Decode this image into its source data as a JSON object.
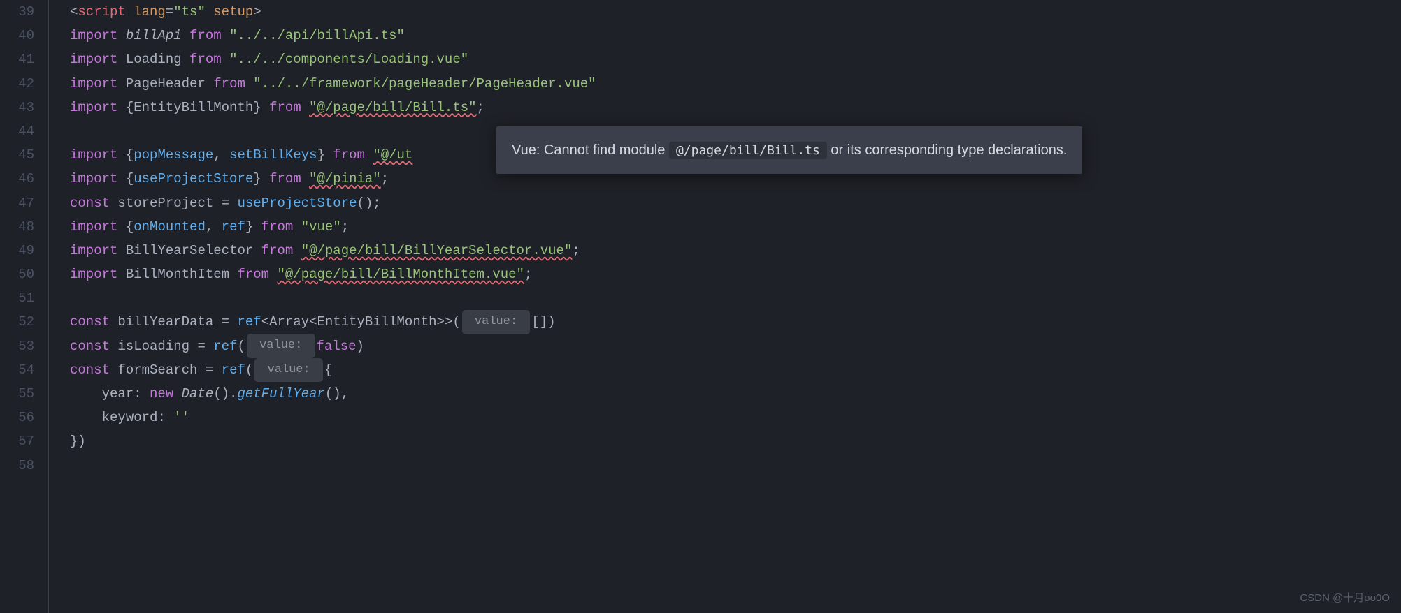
{
  "gutter": [
    "39",
    "40",
    "41",
    "42",
    "43",
    "44",
    "45",
    "46",
    "47",
    "48",
    "49",
    "50",
    "51",
    "52",
    "53",
    "54",
    "55",
    "56",
    "57",
    "58"
  ],
  "l39": {
    "open": "<",
    "script": "script",
    "lang_attr": " lang",
    "eq": "=",
    "lang_val": "\"ts\"",
    "setup": " setup",
    "close": ">"
  },
  "l40": {
    "import": "import ",
    "name": "billApi",
    "from": " from ",
    "path": "\"../../api/billApi.ts\""
  },
  "l41": {
    "import": "import ",
    "name": "Loading",
    "from": " from ",
    "path": "\"../../components/Loading.vue\""
  },
  "l42": {
    "import": "import ",
    "name": "PageHeader",
    "from": " from ",
    "path": "\"../../framework/pageHeader/PageHeader.vue\""
  },
  "l43": {
    "import": "import ",
    "lb": "{",
    "name": "EntityBillMonth",
    "rb": "}",
    "from": " from ",
    "path": "\"@/page/bill/Bill.ts\"",
    "semi": ";"
  },
  "l45": {
    "import": "import ",
    "lb": "{",
    "n1": "popMessage",
    "comma": ", ",
    "n2": "setBillKeys",
    "rb": "}",
    "from": " from ",
    "path": "\"@/ut"
  },
  "l46": {
    "import": "import ",
    "lb": "{",
    "name": "useProjectStore",
    "rb": "}",
    "from": " from ",
    "path": "\"@/pinia\"",
    "semi": ";"
  },
  "l47": {
    "const": "const ",
    "name": "storeProject",
    "eq": " = ",
    "fn": "useProjectStore",
    "call": "();"
  },
  "l48": {
    "import": "import ",
    "lb": "{",
    "n1": "onMounted",
    "comma": ", ",
    "n2": "ref",
    "rb": "}",
    "from": " from ",
    "path": "\"vue\"",
    "semi": ";"
  },
  "l49": {
    "import": "import ",
    "name": "BillYearSelector",
    "from": " from ",
    "path": "\"@/page/bill/BillYearSelector.vue\"",
    "semi": ";"
  },
  "l50": {
    "import": "import ",
    "name": "BillMonthItem",
    "from": " from ",
    "path": "\"@/page/bill/BillMonthItem.vue\"",
    "semi": ";"
  },
  "l52": {
    "const": "const ",
    "name": "billYearData",
    "eq": " = ",
    "ref": "ref",
    "gen": "<Array<EntityBillMonth>>(",
    "hint": " value: ",
    "val": "[])"
  },
  "l53": {
    "const": "const ",
    "name": "isLoading",
    "eq": " = ",
    "ref": "ref",
    "lp": "(",
    "hint": " value: ",
    "val": "false",
    "rp": ")"
  },
  "l54": {
    "const": "const ",
    "name": "formSearch",
    "eq": " = ",
    "ref": "ref",
    "lp": "(",
    "hint": " value: ",
    "lb": "{"
  },
  "l55": {
    "indent": "    ",
    "key": "year",
    "colon": ": ",
    "new": "new ",
    "cls": "Date",
    "call1": "().",
    "fn": "getFullYear",
    "call2": "(),"
  },
  "l56": {
    "indent": "    ",
    "key": "keyword",
    "colon": ": ",
    "val": "''"
  },
  "l57": {
    "close": "})"
  },
  "tooltip": {
    "prefix": "Vue: Cannot find module ",
    "module": "@/page/bill/Bill.ts",
    "suffix": " or its corresponding type declarations."
  },
  "watermark": "CSDN @十月oo0O"
}
